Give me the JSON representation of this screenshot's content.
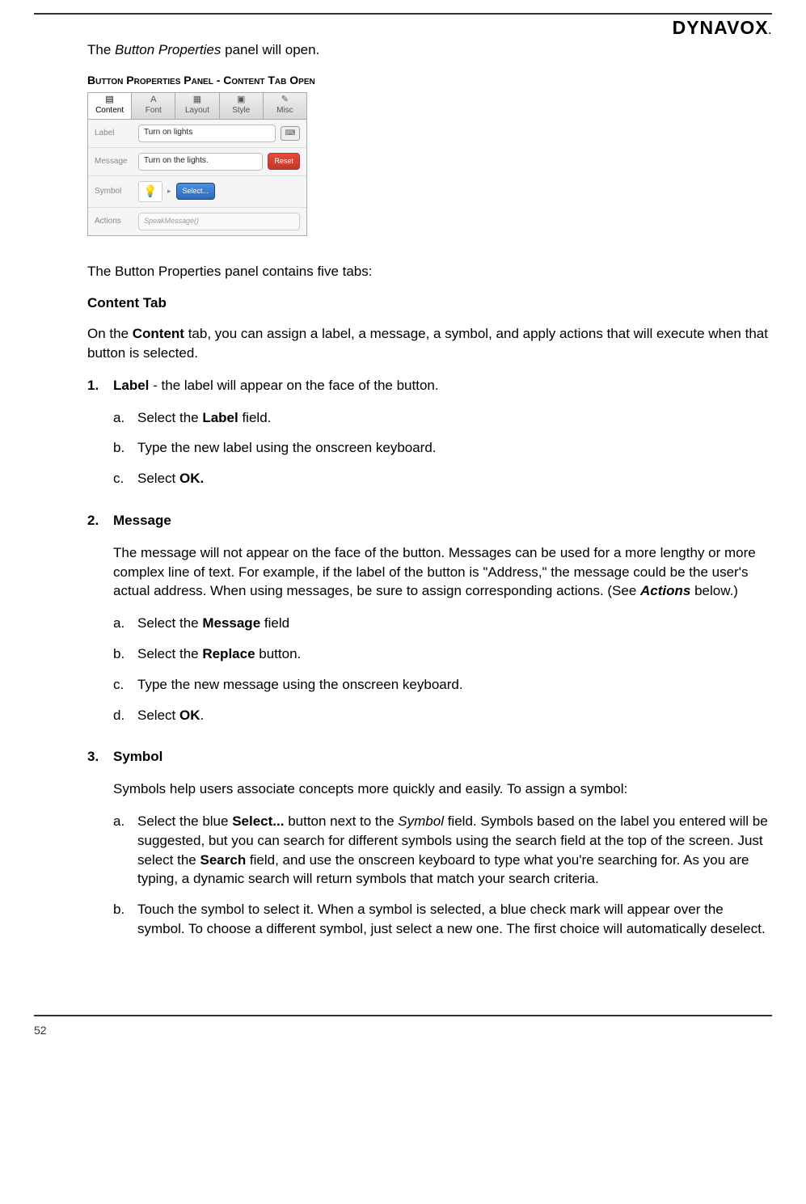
{
  "brand": "DYNAVOX",
  "page_number": "52",
  "intro_line_prefix": "The ",
  "intro_line_italic": "Button Properties",
  "intro_line_suffix": " panel will open.",
  "figure_caption": "Button Properties Panel - Content Tab Open",
  "panel": {
    "tabs": [
      {
        "icon": "▤",
        "label": "Content",
        "active": true
      },
      {
        "icon": "A",
        "label": "Font",
        "active": false
      },
      {
        "icon": "▦",
        "label": "Layout",
        "active": false
      },
      {
        "icon": "▣",
        "label": "Style",
        "active": false
      },
      {
        "icon": "✎",
        "label": "Misc",
        "active": false
      }
    ],
    "rows": {
      "label": {
        "title": "Label",
        "value": "Turn on lights"
      },
      "message": {
        "title": "Message",
        "value": "Turn on the lights.",
        "reset": "Reset"
      },
      "symbol": {
        "title": "Symbol",
        "glyph": "💡",
        "select": "Select..."
      },
      "actions": {
        "title": "Actions",
        "value": "SpeakMessage()"
      }
    }
  },
  "five_tabs_line": "The Button Properties panel contains five tabs:",
  "content_tab_heading": "Content Tab",
  "content_tab_para_prefix": "On the ",
  "content_tab_bold": "Content",
  "content_tab_para_suffix": " tab, you can assign a label, a message, a symbol, and apply actions that will execute when that button is selected.",
  "items": [
    {
      "num": "1.",
      "title": "Label",
      "title_rest": " - the label will appear on the face of the button.",
      "subs": [
        {
          "let": "a.",
          "pre": "Select the ",
          "bold": "Label",
          "post": " field."
        },
        {
          "let": "b.",
          "plain": "Type the new label using the onscreen keyboard."
        },
        {
          "let": "c.",
          "pre": "Select ",
          "bold": "OK.",
          "post": ""
        }
      ]
    },
    {
      "num": "2.",
      "title": "Message",
      "para_pre": "The message will not appear on the face of the button. Messages can be used for a more lengthy or more complex line of text. For example, if the label of the button is \"Address,\" the message could be the user's actual address. When using messages, be sure to assign corresponding actions. (See ",
      "para_bi": "Actions",
      "para_post": " below.)",
      "subs": [
        {
          "let": "a.",
          "pre": "Select the ",
          "bold": "Message",
          "post": " field"
        },
        {
          "let": "b.",
          "pre": "Select the ",
          "bold": "Replace",
          "post": " button."
        },
        {
          "let": "c.",
          "plain": "Type the new message using the onscreen keyboard."
        },
        {
          "let": "d.",
          "pre": "Select ",
          "bold": "OK",
          "post": "."
        }
      ]
    },
    {
      "num": "3.",
      "title": "Symbol",
      "para_plain": "Symbols help users associate concepts more quickly and easily. To assign a symbol:",
      "subs": [
        {
          "let": "a.",
          "pre": "Select the blue ",
          "bold": "Select...",
          "mid1": " button next to the ",
          "italic": "Symbol",
          "mid2": " field. Symbols based on the label you entered will be suggested, but you can search for different symbols using the search field at the top of the screen. Just select the ",
          "bold2": "Search",
          "post": " field, and use the onscreen keyboard to type what you're searching for. As you are typing, a dynamic search will return symbols that match your search criteria."
        },
        {
          "let": "b.",
          "plain": "Touch the symbol to select it. When a symbol is selected, a blue check mark will appear over the symbol. To choose a different symbol, just select a new one. The first choice will automatically deselect."
        }
      ]
    }
  ]
}
